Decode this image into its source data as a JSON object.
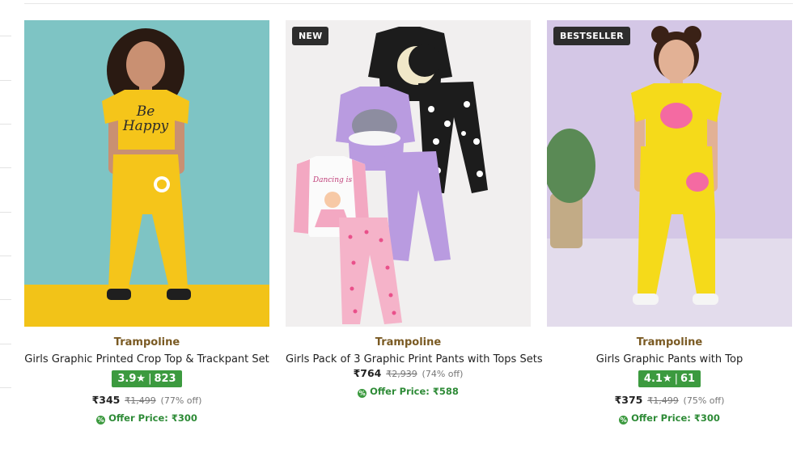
{
  "products": [
    {
      "badge": "",
      "brand": "Trampoline",
      "name": "Girls Graphic Printed Crop Top & Trackpant Set",
      "rating": "3.9",
      "rating_star": "★",
      "rating_sep": "|",
      "reviews": "823",
      "price": "₹345",
      "mrp": "₹1,499",
      "discount": "(77% off)",
      "offer_label": "Offer Price: ₹300",
      "offer_icon": "%",
      "image_text": "be happy"
    },
    {
      "badge": "NEW",
      "brand": "Trampoline",
      "name": "Girls Pack of 3 Graphic Print Pants with Tops Sets",
      "price": "₹764",
      "mrp": "₹2,939",
      "discount": "(74% off)",
      "offer_label": "Offer Price: ₹588",
      "offer_icon": "%"
    },
    {
      "badge": "BESTSELLER",
      "brand": "Trampoline",
      "name": "Girls Graphic Pants with Top",
      "rating": "4.1",
      "rating_star": "★",
      "rating_sep": "|",
      "reviews": "61",
      "price": "₹375",
      "mrp": "₹1,499",
      "discount": "(75% off)",
      "offer_label": "Offer Price: ₹300",
      "offer_icon": "%"
    }
  ],
  "colors": {
    "brand_text": "#7a5a23",
    "rating_bg": "#3c9a3f",
    "offer_text": "#2e8b37",
    "badge_bg": "#2d2d2d"
  }
}
